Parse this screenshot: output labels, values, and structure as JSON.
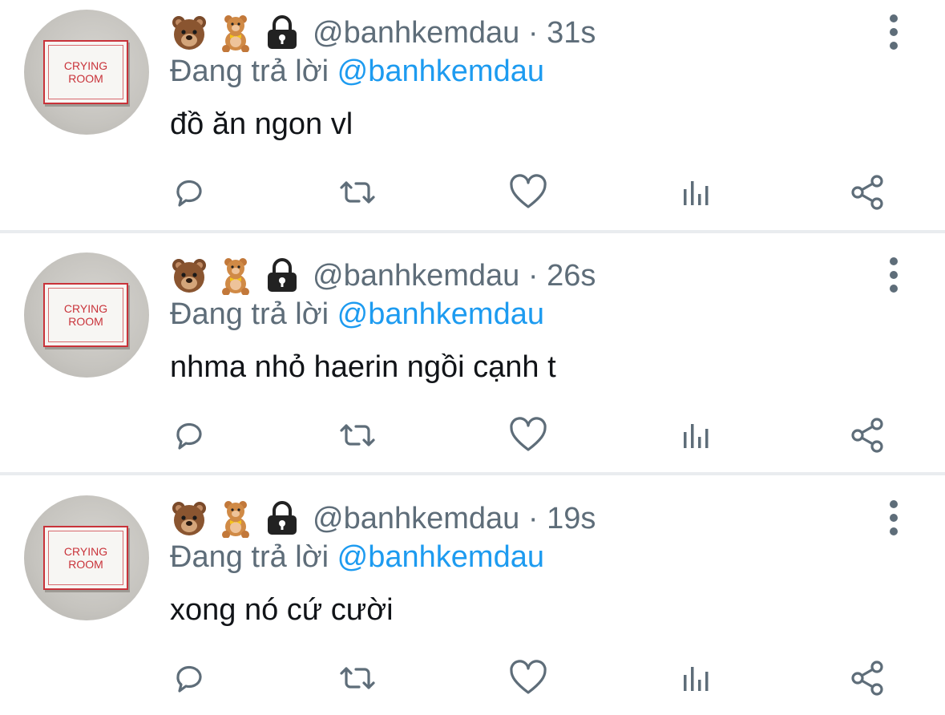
{
  "colors": {
    "text_primary": "#111418",
    "text_secondary": "#5e6d79",
    "mention": "#1d9bf0",
    "divider": "#e9ecef"
  },
  "avatar": {
    "sign_line1": "CRYING",
    "sign_line2": "ROOM"
  },
  "header_icons": [
    "bear-face-emoji",
    "teddy-bear-emoji",
    "lock-icon"
  ],
  "actions": [
    "reply-icon",
    "retweet-icon",
    "like-icon",
    "analytics-icon",
    "share-icon"
  ],
  "tweets": [
    {
      "handle": "@banhkemdau",
      "separator": "·",
      "time": "31s",
      "reply_prefix": "Đang trả lời",
      "reply_to": "@banhkemdau",
      "text": "đồ ăn ngon vl"
    },
    {
      "handle": "@banhkemdau",
      "separator": "·",
      "time": "26s",
      "reply_prefix": "Đang trả lời",
      "reply_to": "@banhkemdau",
      "text": "nhma nhỏ haerin ngồi cạnh t"
    },
    {
      "handle": "@banhkemdau",
      "separator": "·",
      "time": "19s",
      "reply_prefix": "Đang trả lời",
      "reply_to": "@banhkemdau",
      "text": "xong nó cứ cười"
    }
  ]
}
